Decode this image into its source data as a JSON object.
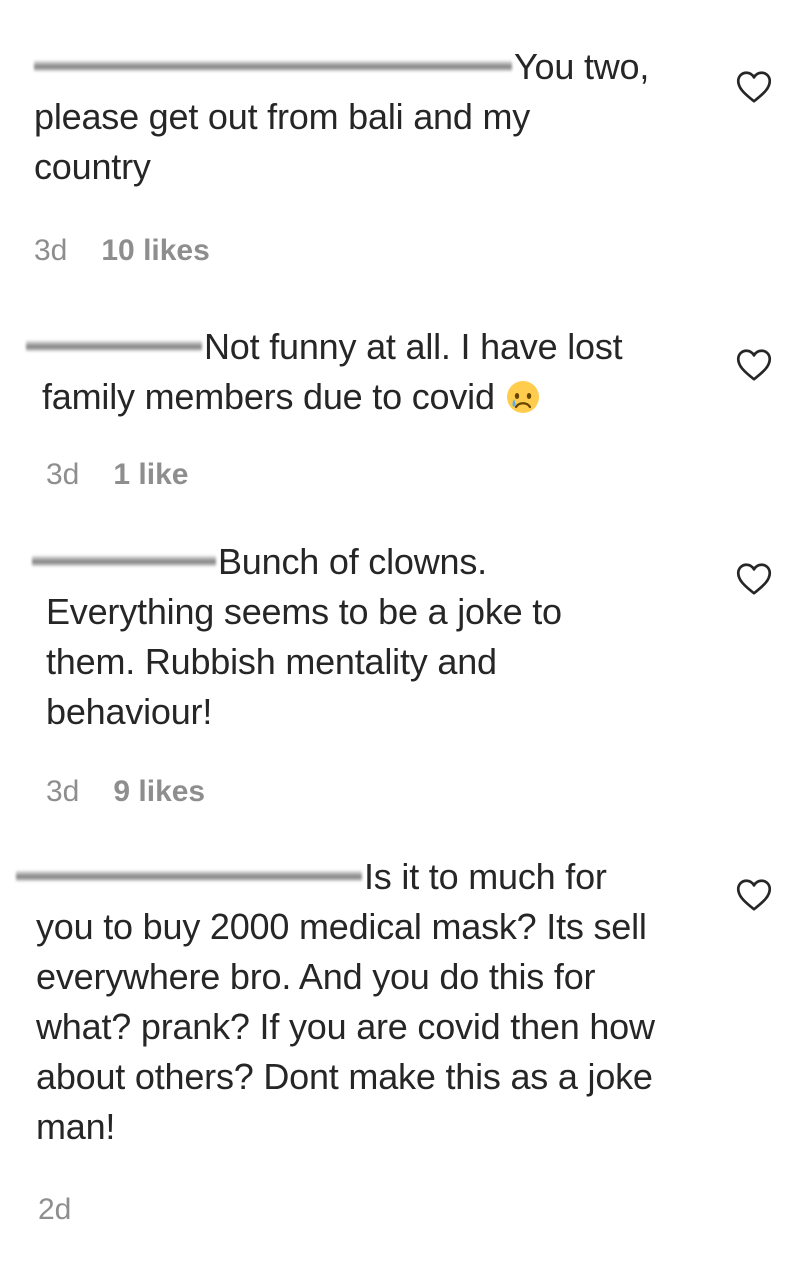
{
  "comments": [
    {
      "text": "You two, please get out from bali and my country",
      "first_line": "You two,",
      "rest": "please get out from bali and my country",
      "time": "3d",
      "likes": "10 likes"
    },
    {
      "text": "Not funny at all. I have lost family members due to covid",
      "first_line": "Not funny at all. I have lost",
      "rest": "family members due to covid",
      "emoji": "crying-face",
      "time": "3d",
      "likes": "1 like"
    },
    {
      "text": "Bunch of clowns. Everything seems to be a joke to them. Rubbish mentality and behaviour!",
      "first_line": "Bunch of clowns.",
      "rest": "Everything seems to be a joke to them. Rubbish mentality and behaviour!",
      "time": "3d",
      "likes": "9 likes"
    },
    {
      "text": "Is it to much for you to buy 2000 medical mask? Its sell everywhere bro. And you do this for what? prank? If you are covid then how about others? Dont make this as a joke man!",
      "first_line": "Is it to much for",
      "rest": "you to buy 2000 medical mask? Its sell everywhere bro. And you do this for what? prank? If you are covid then how about others? Dont make this as a joke man!",
      "time": "2d",
      "likes": ""
    }
  ],
  "icons": {
    "like": "heart-outline-icon",
    "emoji": "crying-face-emoji"
  },
  "colors": {
    "text": "#262626",
    "meta": "#8e8e8e",
    "background": "#ffffff"
  }
}
